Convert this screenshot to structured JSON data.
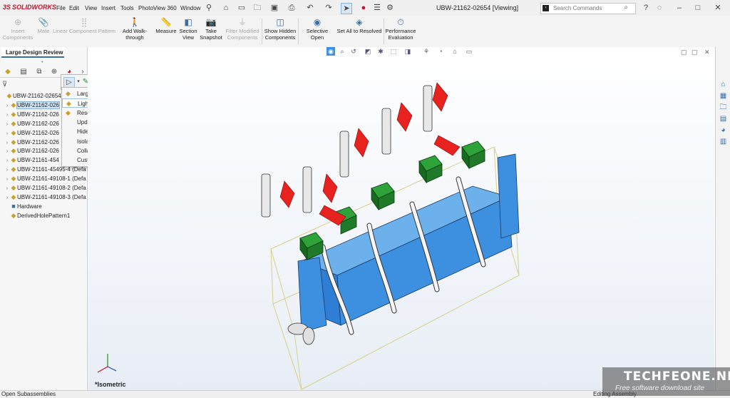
{
  "app": {
    "brand": "SOLIDWORKS",
    "brand_prefix": "3S",
    "document_title": "UBW-21162-02654 [Viewing]"
  },
  "menus": [
    "File",
    "Edit",
    "View",
    "Insert",
    "Tools",
    "PhotoView 360",
    "Window"
  ],
  "search": {
    "placeholder": "Search Commands"
  },
  "command_manager": [
    {
      "label": "Insert Components",
      "enabled": false
    },
    {
      "label": "Mate",
      "enabled": false
    },
    {
      "label": "Linear Component Pattern",
      "enabled": false
    },
    {
      "label": "Add Walk-through",
      "enabled": true
    },
    {
      "label": "Measure",
      "enabled": true
    },
    {
      "label": "Section View",
      "enabled": true
    },
    {
      "label": "Take Snapshot",
      "enabled": true
    },
    {
      "label": "Filter Modified Components",
      "enabled": false
    },
    {
      "label": "Show Hidden Components",
      "enabled": true
    },
    {
      "label": "Selective Open",
      "enabled": true
    },
    {
      "label": "Set All to Resolved",
      "enabled": true
    },
    {
      "label": "Performance Evaluation",
      "enabled": true
    }
  ],
  "left_panel": {
    "tab": "Large Design Review",
    "tree": [
      {
        "label": "UBW-21162-02654",
        "level": 0,
        "selected": false
      },
      {
        "label": "UBW-21162-026",
        "level": 1,
        "selected": true
      },
      {
        "label": "UBW-21162-026",
        "level": 1,
        "selected": false
      },
      {
        "label": "UBW-21162-026",
        "level": 1,
        "selected": false
      },
      {
        "label": "UBW-21162-026",
        "level": 1,
        "selected": false
      },
      {
        "label": "UBW-21162-026",
        "level": 1,
        "selected": false
      },
      {
        "label": "UBW-21162-026",
        "level": 1,
        "selected": false
      },
      {
        "label": "UBW-21161-454",
        "level": 1,
        "selected": false
      },
      {
        "label": "UBW-21161-45495-4 (Defa",
        "level": 1,
        "selected": false
      },
      {
        "label": "UBW-21161-49108-1 (Defa",
        "level": 1,
        "selected": false
      },
      {
        "label": "UBW-21161-49108-2 (Defa",
        "level": 1,
        "selected": false
      },
      {
        "label": "UBW-21161-49108-3 (Defa",
        "level": 1,
        "selected": false
      },
      {
        "label": "Hardware",
        "level": 1,
        "selected": false
      },
      {
        "label": "DerivedHolePattern1",
        "level": 1,
        "selected": false
      }
    ]
  },
  "context_menu": {
    "items": [
      {
        "label": "Large Design Review",
        "highlight": false
      },
      {
        "label": "Lightweight",
        "highlight": true
      },
      {
        "label": "Resolved",
        "highlight": false
      },
      {
        "label": "Update Component Graphics",
        "highlight": false
      },
      {
        "label": "Hide Others",
        "highlight": false
      },
      {
        "label": "Isolate",
        "highlight": false
      },
      {
        "label": "Collapse Items",
        "highlight": false
      },
      {
        "label": "Customize Menu",
        "highlight": false
      }
    ]
  },
  "viewport": {
    "view_label": "*Isometric"
  },
  "status": {
    "left": "Open Subassemblies",
    "right": "Editing Assembly"
  },
  "watermark": {
    "line1": "TECHFEONE.NET",
    "line2": "Free software download site"
  },
  "colors": {
    "accent": "#3a6ea5",
    "handle_red": "#e8231f",
    "block_green": "#1f7a2a",
    "manifold_blue": "#3d8fe0"
  }
}
